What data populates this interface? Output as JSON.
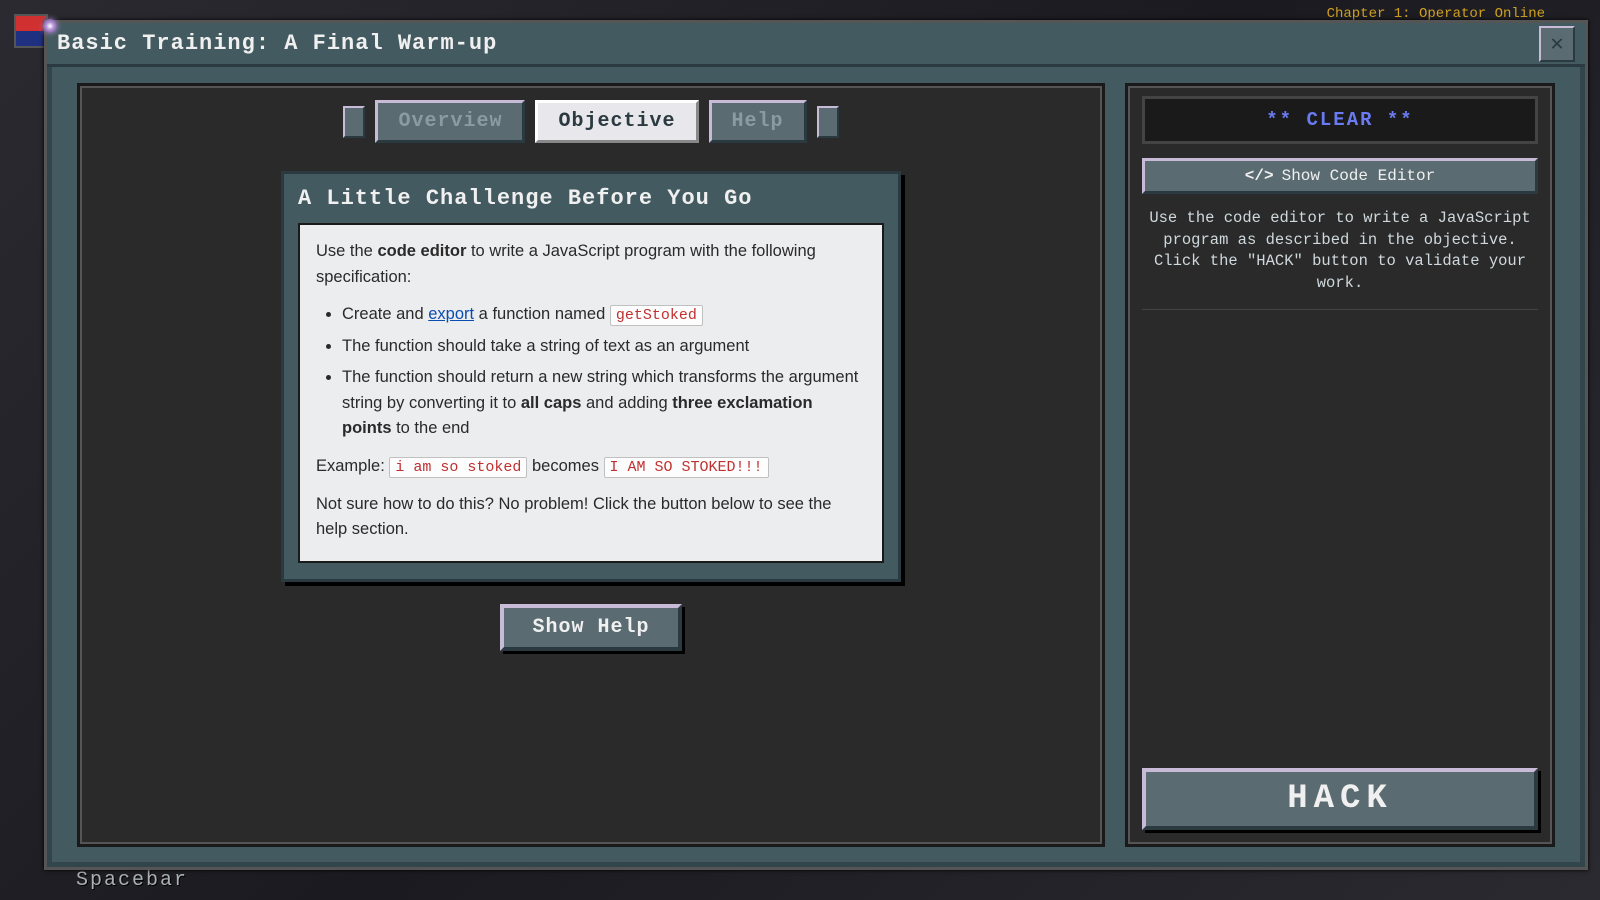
{
  "chapter_link": "Chapter 1: Operator Online",
  "window": {
    "title": "Basic Training: A Final Warm-up",
    "close_symbol": "✕"
  },
  "tabs": {
    "overview": "Overview",
    "objective": "Objective",
    "help": "Help"
  },
  "card": {
    "title": "A Little Challenge Before You Go",
    "intro_pre": "Use the ",
    "intro_bold": "code editor",
    "intro_post": " to write a JavaScript program with the following specification:",
    "li1_pre": "Create and ",
    "li1_link": "export",
    "li1_mid": " a function named ",
    "li1_code": "getStoked",
    "li2": "The function should take a string of text as an argument",
    "li3_pre": "The function should return a new string which transforms the argument string by converting it to ",
    "li3_b1": "all caps",
    "li3_mid": " and adding ",
    "li3_b2": "three exclamation points",
    "li3_post": " to the end",
    "example_label": "Example: ",
    "example_code1": "i am so stoked",
    "example_mid": " becomes ",
    "example_code2": "I AM SO STOKED!!!",
    "outro": "Not sure how to do this? No problem! Click the button below to see the help section."
  },
  "show_help": "Show Help",
  "side": {
    "clear": "** CLEAR **",
    "show_editor": "Show Code Editor",
    "instruction": "Use the code editor to write a JavaScript program as described in the objective. Click the \"HACK\" button to validate your work.",
    "hack": "HACK"
  },
  "spacebar": "Spacebar"
}
